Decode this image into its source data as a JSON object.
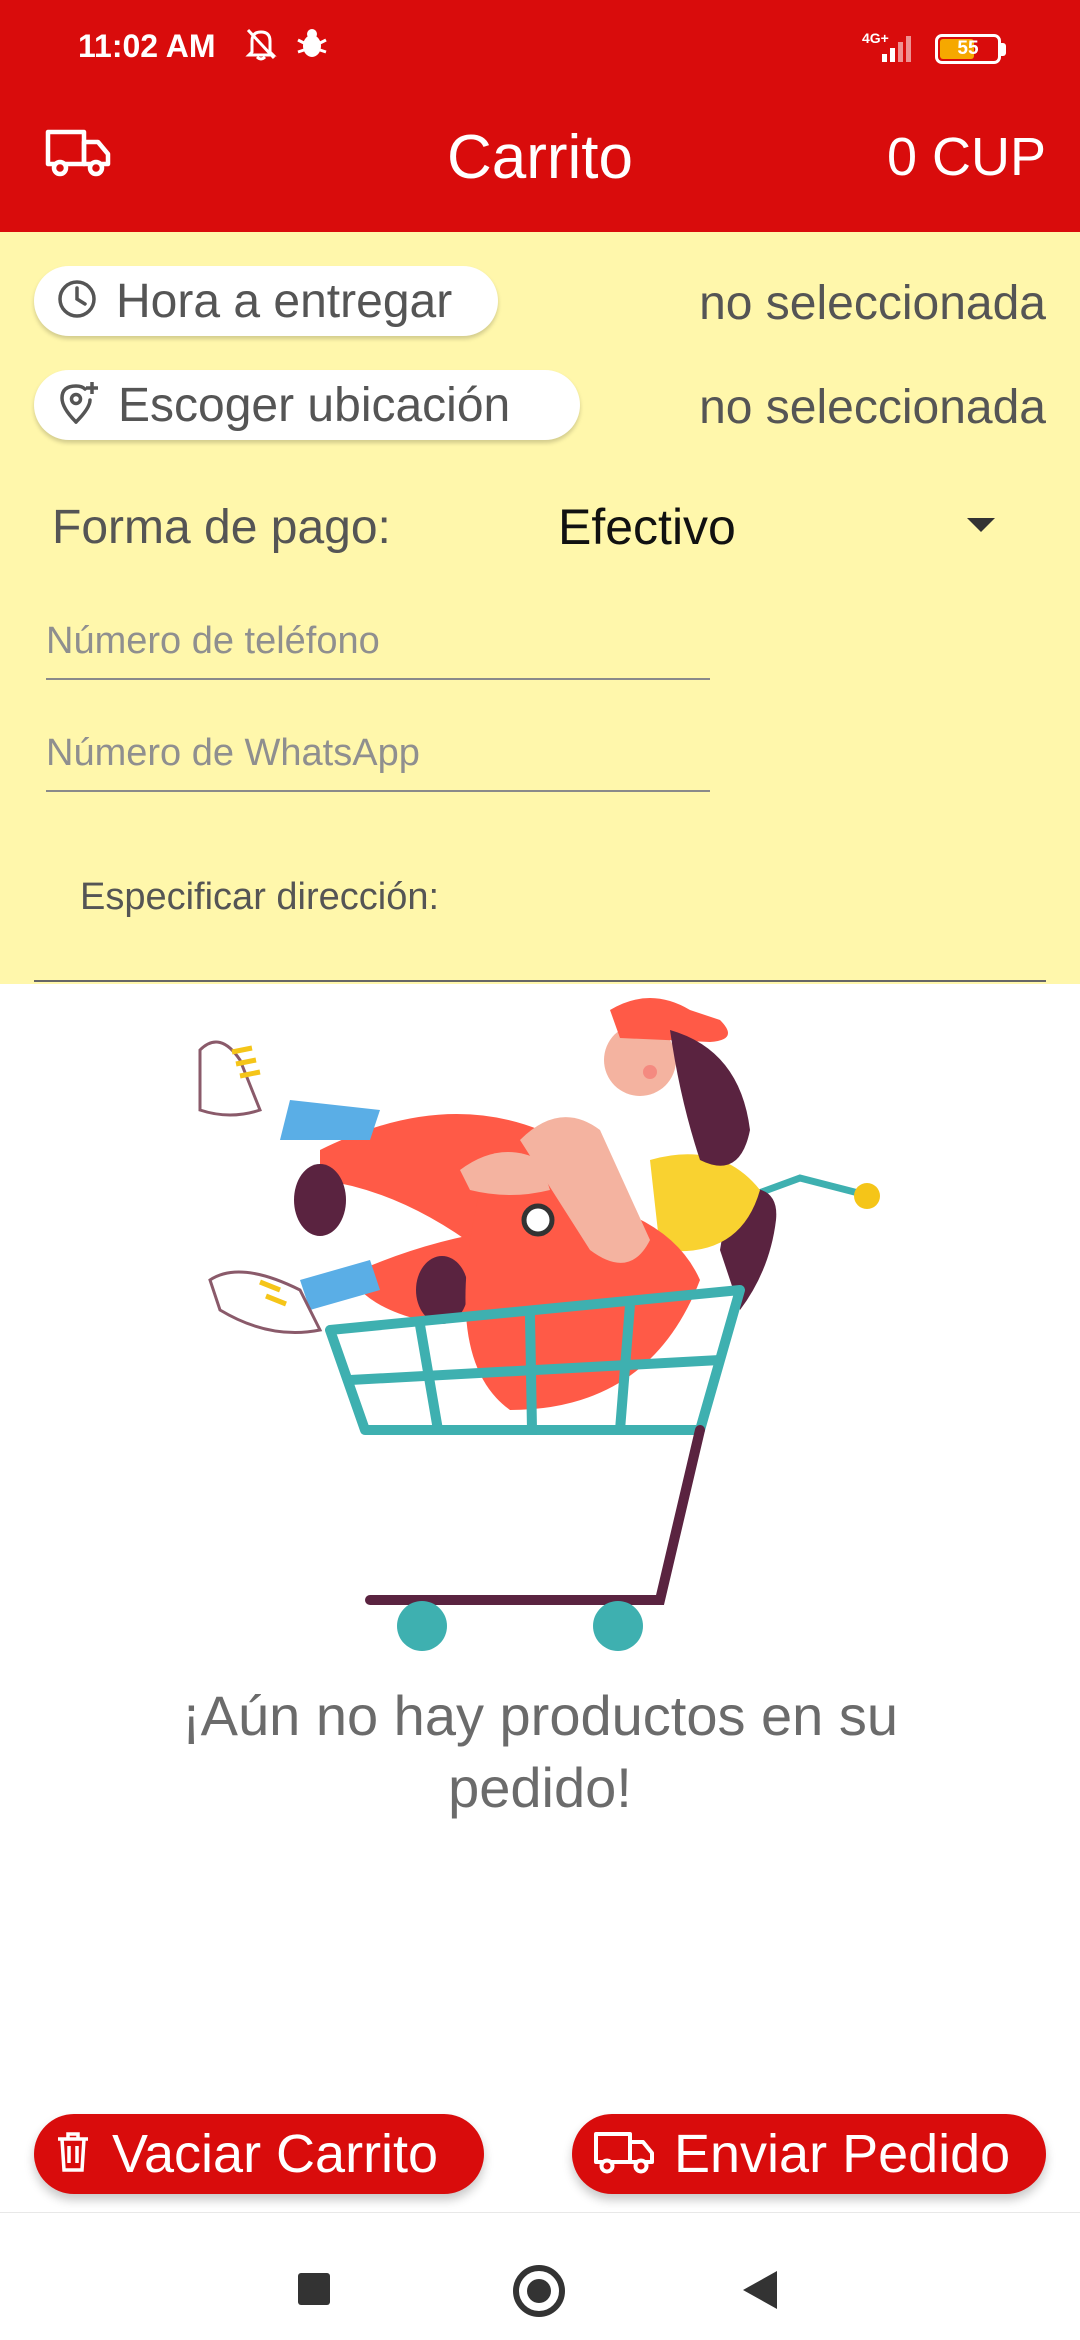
{
  "status_bar": {
    "time": "11:02 AM",
    "network": "4G+",
    "battery": "55",
    "icons": [
      "bell-off-icon",
      "bug-icon",
      "signal-icon",
      "battery-icon"
    ]
  },
  "app_bar": {
    "title": "Carrito",
    "total": "0 CUP",
    "left_icon": "delivery-truck-icon"
  },
  "form": {
    "delivery_time": {
      "label": "Hora a entregar",
      "value": "no seleccionada",
      "icon": "clock-icon"
    },
    "location": {
      "label": "Escoger ubicación",
      "value": "no seleccionada",
      "icon": "location-add-icon"
    },
    "payment": {
      "label": "Forma de pago:",
      "selected": "Efectivo"
    },
    "phone": {
      "placeholder": "Número de teléfono"
    },
    "whatsapp": {
      "placeholder": "Número de WhatsApp"
    },
    "address": {
      "label": "Especificar dirección:"
    }
  },
  "empty_state": {
    "message": "¡Aún no hay productos en su pedido!",
    "illustration": "girl-in-shopping-cart"
  },
  "actions": {
    "clear_label": "Vaciar Carrito",
    "clear_icon": "trash-icon",
    "send_label": "Enviar Pedido",
    "send_icon": "delivery-truck-icon"
  },
  "colors": {
    "primary": "#d90c0c",
    "form_background": "#fff7ab",
    "text_muted": "#6b6b6b"
  }
}
